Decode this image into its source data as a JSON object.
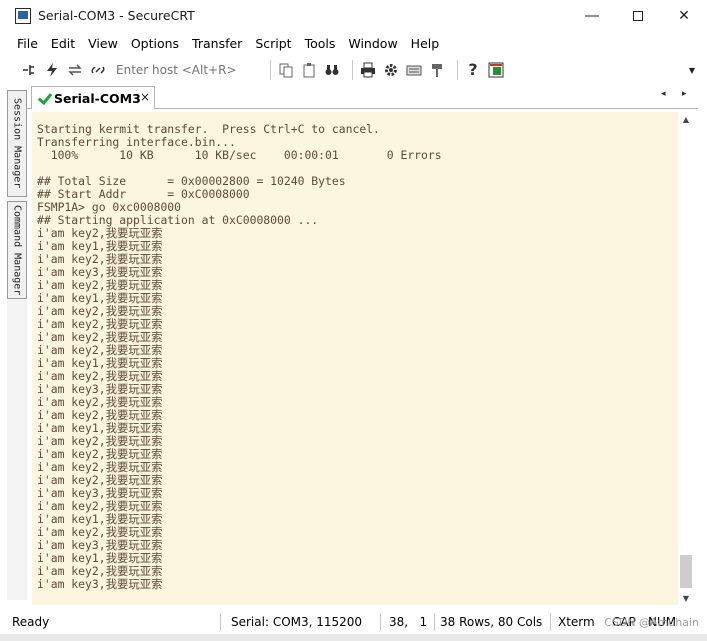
{
  "window": {
    "title": "Serial-COM3 - SecureCRT",
    "minimize_icon": "minimize-icon",
    "maximize_icon": "maximize-icon",
    "close_icon": "close-icon"
  },
  "menu": [
    "File",
    "Edit",
    "View",
    "Options",
    "Transfer",
    "Script",
    "Tools",
    "Window",
    "Help"
  ],
  "toolbar": {
    "host_placeholder": "Enter host <Alt+R>",
    "icons": [
      "connect-icon",
      "quick-connect-icon",
      "reconnect-icon",
      "disconnect-icon",
      "copy-icon",
      "paste-icon",
      "find-icon",
      "print-icon",
      "settings-icon",
      "keymap-icon",
      "sftp-icon",
      "help-icon",
      "about-icon"
    ]
  },
  "side_panel": {
    "session_manager": "Session Manager",
    "command_manager": "Command Manager"
  },
  "tabs": {
    "active": "Serial-COM3",
    "close": "×",
    "prev": "◂",
    "next": "▸"
  },
  "terminal": {
    "lines": [
      "Starting kermit transfer.  Press Ctrl+C to cancel.",
      "Transferring interface.bin...",
      "  100%      10 KB      10 KB/sec    00:00:01       0 Errors",
      "",
      "## Total Size      = 0x00002800 = 10240 Bytes",
      "## Start Addr      = 0xC0008000",
      "FSMP1A> go 0xc0008000",
      "## Starting application at 0xC0008000 ...",
      "i'am key2,我要玩亚索",
      "i'am key1,我要玩亚索",
      "i'am key2,我要玩亚索",
      "i'am key3,我要玩亚索",
      "i'am key2,我要玩亚索",
      "i'am key1,我要玩亚索",
      "i'am key2,我要玩亚索",
      "i'am key2,我要玩亚索",
      "i'am key2,我要玩亚索",
      "i'am key2,我要玩亚索",
      "i'am key1,我要玩亚索",
      "i'am key2,我要玩亚索",
      "i'am key3,我要玩亚索",
      "i'am key2,我要玩亚索",
      "i'am key2,我要玩亚索",
      "i'am key1,我要玩亚索",
      "i'am key2,我要玩亚索",
      "i'am key2,我要玩亚索",
      "i'am key2,我要玩亚索",
      "i'am key2,我要玩亚索",
      "i'am key3,我要玩亚索",
      "i'am key2,我要玩亚索",
      "i'am key1,我要玩亚索",
      "i'am key2,我要玩亚索",
      "i'am key3,我要玩亚索",
      "i'am key1,我要玩亚索",
      "i'am key2,我要玩亚索",
      "i'am key3,我要玩亚索"
    ],
    "background": "#fcf5e0",
    "text_color": "#5e4a3a"
  },
  "status": {
    "ready": "Ready",
    "serial": "Serial: COM3, 115200",
    "position": "38,   1",
    "size": "38 Rows, 80 Cols",
    "terminal": "Xterm",
    "caps": "CAP",
    "num": "NUM",
    "watermark": "CSDN @Amuhain"
  }
}
